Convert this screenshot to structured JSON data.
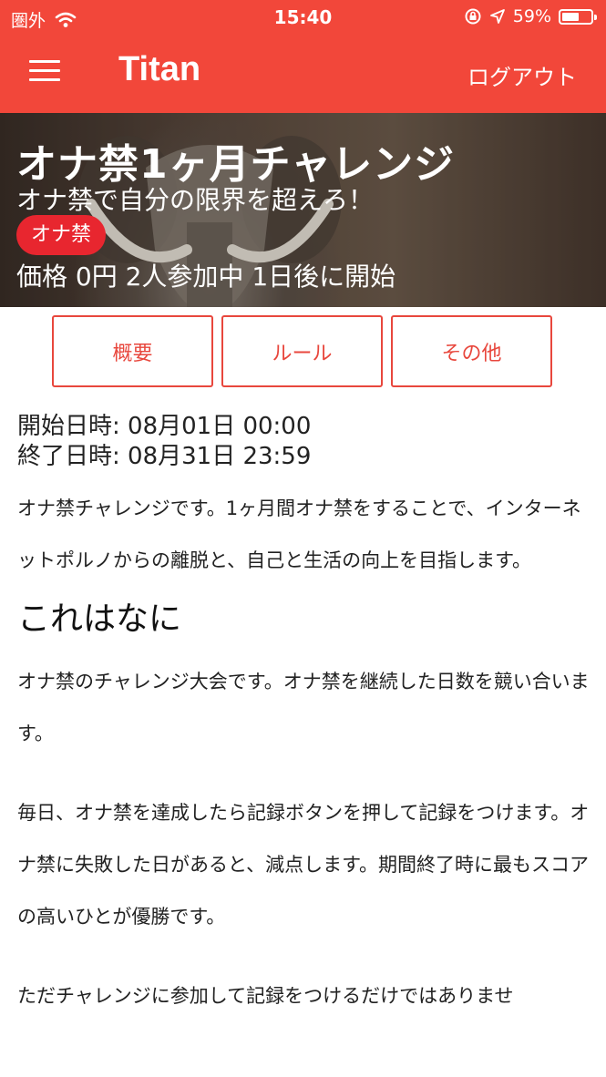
{
  "status_bar": {
    "carrier": "圏外",
    "time": "15:40",
    "battery_percent": "59%",
    "battery_level": 0.59
  },
  "navbar": {
    "title": "Titan",
    "logout_label": "ログアウト"
  },
  "hero": {
    "title": "オナ禁1ヶ月チャレンジ",
    "subtitle": "オナ禁で自分の限界を超えろ！",
    "tag": "オナ禁",
    "meta": "価格 0円 2人参加中 1日後に開始"
  },
  "tabs": [
    {
      "label": "概要"
    },
    {
      "label": "ルール"
    },
    {
      "label": "その他"
    }
  ],
  "content": {
    "start": "開始日時: 08月01日 00:00",
    "end": "終了日時: 08月31日 23:59",
    "intro": "オナ禁チャレンジです。1ヶ月間オナ禁をすることで、インターネットポルノからの離脱と、自己と生活の向上を目指します。",
    "heading": "これはなに",
    "p1": "オナ禁のチャレンジ大会です。オナ禁を継続した日数を競い合います。",
    "p2": "毎日、オナ禁を達成したら記録ボタンを押して記録をつけます。オナ禁に失敗した日があると、減点します。期間終了時に最もスコアの高いひとが優勝です。",
    "p3": "ただチャレンジに参加して記録をつけるだけではありませ"
  },
  "colors": {
    "accent": "#f2473a",
    "tab_border": "#e8473d",
    "tag": "#e8262f"
  }
}
